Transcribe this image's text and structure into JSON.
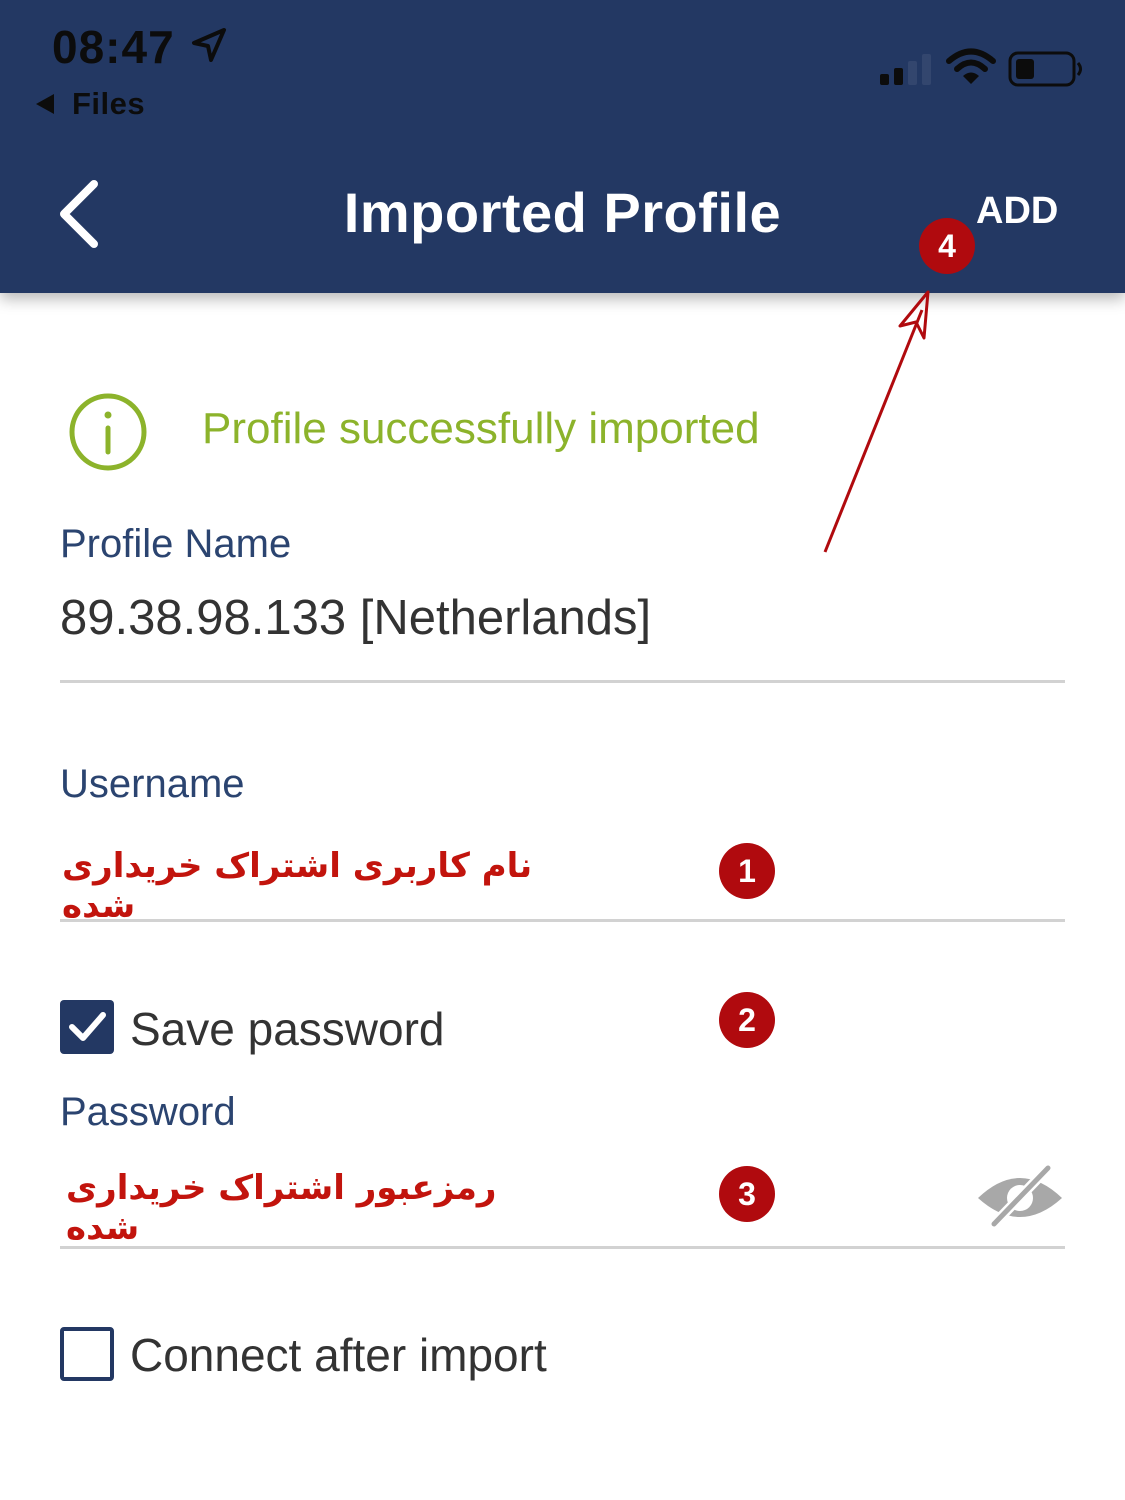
{
  "status_bar": {
    "time": "08:47",
    "back_app": "Files"
  },
  "nav": {
    "title": "Imported Profile",
    "add_label": "ADD"
  },
  "banner": {
    "message": "Profile successfully imported"
  },
  "profile_name": {
    "label": "Profile Name",
    "value": "89.38.98.133 [Netherlands]"
  },
  "username": {
    "label": "Username",
    "value": "نام کاربری اشتراک خریداری شده"
  },
  "save_password": {
    "label": "Save password",
    "checked": true
  },
  "password": {
    "label": "Password",
    "value": "رمزعبور اشتراک خریداری شده"
  },
  "connect_after_import": {
    "label": "Connect after import",
    "checked": false
  },
  "markers": {
    "one": "1",
    "two": "2",
    "three": "3",
    "four": "4"
  },
  "colors": {
    "header": "#233863",
    "success": "#8cb32b",
    "label": "#2b4470",
    "marker": "#b00a0e",
    "annotation_text": "#c2140d"
  },
  "icons": {
    "back": "chevron-left-icon",
    "info": "info-circle-icon",
    "check": "checkmark-icon",
    "eye_off": "eye-off-icon",
    "location": "location-arrow-icon",
    "signal": "cellular-signal-icon",
    "wifi": "wifi-icon",
    "battery": "battery-icon"
  }
}
